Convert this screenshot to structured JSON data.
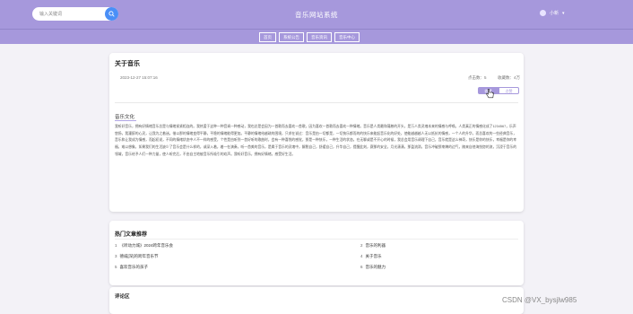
{
  "header": {
    "search_placeholder": "输入关键词",
    "site_title": "音乐网站系统",
    "username": "小新",
    "theme_color": "#a698dc",
    "search_button_color": "#4a8ff7"
  },
  "nav": {
    "items": [
      {
        "label": "首页"
      },
      {
        "label": "系统公告"
      },
      {
        "label": "音乐资讯"
      },
      {
        "label": "音乐中心"
      }
    ]
  },
  "article": {
    "title": "关于音乐",
    "datetime": "2023-12-27 15:07:16",
    "clicks": "点击数：5",
    "favorites": "收藏数：4万",
    "collect_label": "收藏",
    "like_label": "点赞",
    "section_title": "音乐文化",
    "body": "我听好音乐，拥有好情绪音乐总是与情绪紧紧相连的。我热爱于这种一种音调一种感动，我也总是会因为一首歌而去喜欢一首歌，因为喜欢一首歌而去喜欢一种情绪。音乐是人类最和蔼慈的开头，是万人类灵魂本来的情感与呼唤。人类真正的情感化成了1234567，乐声悠扬，我灌醉的心灵，让我为之着迷。借以那的情绪变得平静，平稳的情绪能得更加。平静的情绪给越疏的困境，只求在说过：音乐是由一切都是，一切快乐都而的的快乐来能起音乐化的好处，使能越越越人无以抵抗的情感，一个人的升华，而总喜欢的一些经典音乐，音乐和让我成为情感，而起初说，不同的情绪状态中人不一样的感受，个性是由听到一首好听的歌曲时，会有一种喜悦的感觉，那是一种快乐，一种生活的状态。在无聊或是不开心的时候，我总会用音乐调理下自己，音乐就是这么神奇，快乐是你的快乐，幸福是你的幸福，难以想象，如果我们的生活缺少了音乐会是什么样的，或深入着，着一在演奏，听一首美的音乐，是属于音乐的灵魂中，解脱自己，舒缓自己，升华自己，提醒此刻，赛那的安全，月光潇潇，那盈流淌，音乐冲破那束缚的边气，随来自他海恍惚的流，沉浸于音乐的领域，音乐给予人们一种力量，使人听完后，不由自主地被音乐所吸引的欢声。我听好音乐，拥有好情绪，感受好生活。"
  },
  "hot": {
    "title": "热门文章推荐",
    "items": [
      {
        "num": "1",
        "title": "《听动力城》2024跨年音乐会"
      },
      {
        "num": "2",
        "title": "音乐的利器"
      },
      {
        "num": "3",
        "title": "德威[深]的跨年音乐节"
      },
      {
        "num": "4",
        "title": "关于音乐"
      },
      {
        "num": "5",
        "title": "喜欢音乐的孩子"
      },
      {
        "num": "6",
        "title": "音乐的魅力"
      }
    ]
  },
  "comments": {
    "title": "评论区"
  },
  "watermark": "CSDN @VX_bysjlw985"
}
